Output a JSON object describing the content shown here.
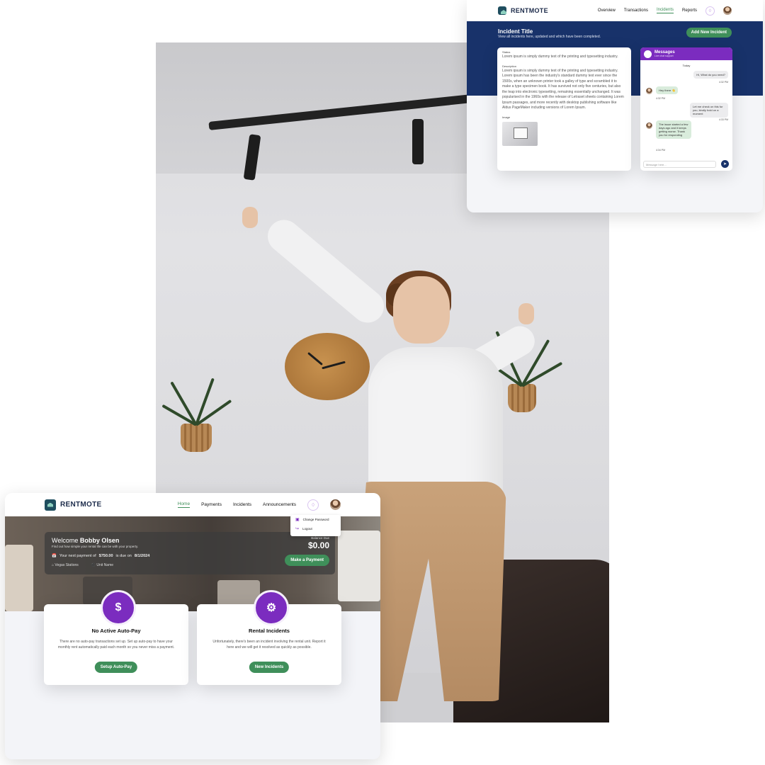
{
  "incident_window": {
    "brand": "RENTMOTE",
    "nav": [
      "Overview",
      "Transactions",
      "Incidents",
      "Reports"
    ],
    "active_nav": "Incidents",
    "title": "Incident Title",
    "subtitle": "View all incidents here, updated and which have been completed.",
    "add_button": "Add New Incident",
    "detail": {
      "status_label": "Status",
      "status_text": "Lorem ipsum is simply dummy text of the printing and typesetting industry.",
      "description_label": "Description",
      "description_text": "Lorem ipsum is simply dummy text of the printing and typesetting industry. Lorem ipsum has been the industry's standard dummy text ever since the 1500s, when an unknown printer took a galley of type and scrambled it to make a type specimen book. It has survived not only five centuries, but also the leap into electronic typesetting, remaining essentially unchanged. It was popularised in the 1960s with the release of Letraset sheets containing Lorem Ipsum passages, and more recently with desktop publishing software like Aldus PageMaker including versions of Lorem Ipsum.",
      "image_label": "Image"
    },
    "messages": {
      "title": "Messages",
      "subtitle": "Live chat support",
      "day": "Today",
      "items": [
        {
          "dir": "out",
          "text": "Hi, What do you need?",
          "time": "4:32 PM"
        },
        {
          "dir": "in",
          "text": "Hey there 👋",
          "time": "4:32 PM"
        },
        {
          "dir": "out",
          "text": "Let me check on this for you, kindly hold on a moment",
          "time": "4:33 PM"
        },
        {
          "dir": "in",
          "text": "The issue started a few days ago and it keeps getting worse. Thank you for responding",
          "time": "4:34 PM"
        }
      ],
      "input_placeholder": "Message here..."
    }
  },
  "dashboard_window": {
    "brand": "RENTMOTE",
    "nav": [
      "Home",
      "Payments",
      "Incidents",
      "Announcements"
    ],
    "active_nav": "Home",
    "dropdown": [
      "Change Password",
      "Logout"
    ],
    "welcome_prefix": "Welcome",
    "user_name": "Bobby Olsen",
    "welcome_sub": "Find out how simple your rental life can be with your property.",
    "next_payment_prefix": "Your next payment of",
    "next_payment_amount": "$750.00",
    "next_payment_mid": "is due on",
    "next_payment_date": "8/1/2024",
    "meta": [
      "Vegas Stations",
      "Unit Name"
    ],
    "balance_label": "Balance Due",
    "balance": "$0.00",
    "pay_button": "Make a Payment",
    "cards": [
      {
        "icon": "dollar-refresh-icon",
        "title": "No Active Auto-Pay",
        "text": "There are no auto-pay transactions set up. Set up auto-pay to have your monthly rent automatically paid each month so you never miss a payment.",
        "button": "Setup Auto-Pay"
      },
      {
        "icon": "wrench-gear-icon",
        "title": "Rental Incidents",
        "text": "Unfortunately, there's been an incident involving the rental unit. Report it here and we will get it resolved as quickly as possible.",
        "button": "New Incidents"
      }
    ]
  },
  "colors": {
    "brand_green": "#3f8f5a",
    "brand_purple": "#7b2cbf",
    "brand_navy": "#18326a"
  }
}
